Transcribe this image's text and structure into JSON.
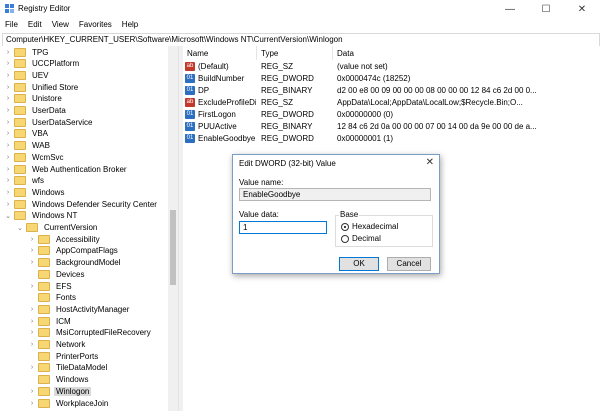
{
  "window": {
    "title": "Registry Editor"
  },
  "menu": [
    "File",
    "Edit",
    "View",
    "Favorites",
    "Help"
  ],
  "address": "Computer\\HKEY_CURRENT_USER\\Software\\Microsoft\\Windows NT\\CurrentVersion\\Winlogon",
  "tree": [
    {
      "label": "TPG",
      "level": 0,
      "expand": ">"
    },
    {
      "label": "UCCPlatform",
      "level": 0,
      "expand": ">"
    },
    {
      "label": "UEV",
      "level": 0,
      "expand": ">"
    },
    {
      "label": "Unified Store",
      "level": 0,
      "expand": ">"
    },
    {
      "label": "Unistore",
      "level": 0,
      "expand": ">"
    },
    {
      "label": "UserData",
      "level": 0,
      "expand": ">"
    },
    {
      "label": "UserDataService",
      "level": 0,
      "expand": ">"
    },
    {
      "label": "VBA",
      "level": 0,
      "expand": ">"
    },
    {
      "label": "WAB",
      "level": 0,
      "expand": ">"
    },
    {
      "label": "WcmSvc",
      "level": 0,
      "expand": ">"
    },
    {
      "label": "Web Authentication Broker",
      "level": 0,
      "expand": ">"
    },
    {
      "label": "wfs",
      "level": 0,
      "expand": ">"
    },
    {
      "label": "Windows",
      "level": 0,
      "expand": ">"
    },
    {
      "label": "Windows Defender Security Center",
      "level": 0,
      "expand": ">"
    },
    {
      "label": "Windows NT",
      "level": 0,
      "expand": "v"
    },
    {
      "label": "CurrentVersion",
      "level": 1,
      "expand": "v"
    },
    {
      "label": "Accessibility",
      "level": 2,
      "expand": ">"
    },
    {
      "label": "AppCompatFlags",
      "level": 2,
      "expand": ">"
    },
    {
      "label": "BackgroundModel",
      "level": 2,
      "expand": ">"
    },
    {
      "label": "Devices",
      "level": 2,
      "expand": ""
    },
    {
      "label": "EFS",
      "level": 2,
      "expand": ">"
    },
    {
      "label": "Fonts",
      "level": 2,
      "expand": ""
    },
    {
      "label": "HostActivityManager",
      "level": 2,
      "expand": ">"
    },
    {
      "label": "ICM",
      "level": 2,
      "expand": ">"
    },
    {
      "label": "MsiCorruptedFileRecovery",
      "level": 2,
      "expand": ">"
    },
    {
      "label": "Network",
      "level": 2,
      "expand": ">"
    },
    {
      "label": "PrinterPorts",
      "level": 2,
      "expand": ""
    },
    {
      "label": "TileDataModel",
      "level": 2,
      "expand": ">"
    },
    {
      "label": "Windows",
      "level": 2,
      "expand": ""
    },
    {
      "label": "Winlogon",
      "level": 2,
      "expand": ">",
      "selected": true
    },
    {
      "label": "WorkplaceJoin",
      "level": 2,
      "expand": ">"
    }
  ],
  "list": {
    "columns": [
      "Name",
      "Type",
      "Data"
    ],
    "rows": [
      {
        "icon": "string",
        "name": "(Default)",
        "type": "REG_SZ",
        "data": "(value not set)"
      },
      {
        "icon": "binary",
        "name": "BuildNumber",
        "type": "REG_DWORD",
        "data": "0x0000474c (18252)"
      },
      {
        "icon": "binary",
        "name": "DP",
        "type": "REG_BINARY",
        "data": "d2 00 e8 00 09 00 00 00 08 00 00 00 12 84 c6 2d 00 0..."
      },
      {
        "icon": "string",
        "name": "ExcludeProfileDirs",
        "type": "REG_SZ",
        "data": "AppData\\Local;AppData\\LocalLow;$Recycle.Bin;O..."
      },
      {
        "icon": "binary",
        "name": "FirstLogon",
        "type": "REG_DWORD",
        "data": "0x00000000 (0)"
      },
      {
        "icon": "binary",
        "name": "PUUActive",
        "type": "REG_BINARY",
        "data": "12 84 c6 2d 0a 00 00 00 07 00 14 00 da 9e 00 00 de a..."
      },
      {
        "icon": "binary",
        "name": "EnableGoodbye",
        "type": "REG_DWORD",
        "data": "0x00000001 (1)"
      }
    ]
  },
  "dialog": {
    "title": "Edit DWORD (32-bit) Value",
    "value_name_label": "Value name:",
    "value_name": "EnableGoodbye",
    "value_data_label": "Value data:",
    "value_data": "1",
    "base_label": "Base",
    "hex_label": "Hexadecimal",
    "dec_label": "Decimal",
    "base_selected": "Hexadecimal",
    "ok": "OK",
    "cancel": "Cancel"
  },
  "colors": {
    "folder": "#f7d674",
    "selection": "#d9d9d9",
    "accent": "#0078d7"
  }
}
